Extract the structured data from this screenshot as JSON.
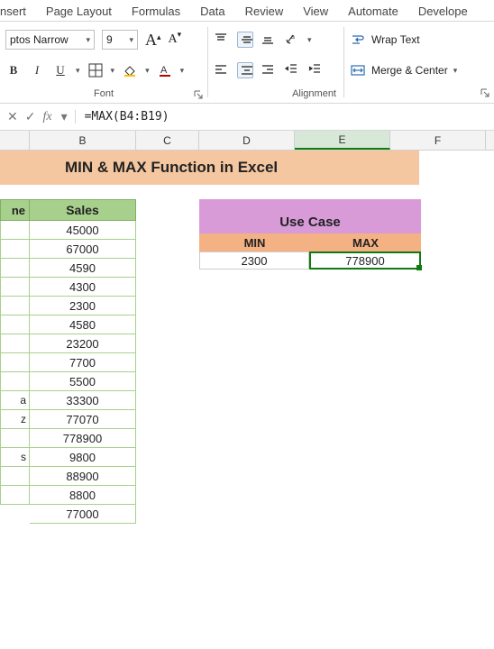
{
  "tabs": {
    "insert": "nsert",
    "page_layout": "Page Layout",
    "formulas": "Formulas",
    "data": "Data",
    "review": "Review",
    "view": "View",
    "automate": "Automate",
    "developer": "Develope"
  },
  "ribbon": {
    "font_name": "ptos Narrow",
    "font_size": "9",
    "group_font": "Font",
    "group_align": "Alignment",
    "wrap": "Wrap Text",
    "merge": "Merge & Center",
    "bold": "B",
    "italic": "I",
    "underline": "U"
  },
  "fbar": {
    "formula": "=MAX(B4:B19)",
    "fx": "fx"
  },
  "cols": {
    "B": "B",
    "C": "C",
    "D": "D",
    "E": "E",
    "F": "F"
  },
  "title": "MIN & MAX Function in Excel",
  "headers": {
    "name": "ne",
    "sales": "Sales"
  },
  "name_tail": [
    "",
    "",
    "",
    "",
    "",
    "",
    "",
    "",
    "",
    "a",
    "z",
    "",
    "s",
    "",
    ""
  ],
  "sales": [
    "45000",
    "67000",
    "4590",
    "4300",
    "2300",
    "4580",
    "23200",
    "7700",
    "5500",
    "33300",
    "77070",
    "778900",
    "9800",
    "88900",
    "8800",
    "77000"
  ],
  "usecase": {
    "title": "Use Case",
    "min_lbl": "MIN",
    "max_lbl": "MAX",
    "min": "2300",
    "max": "778900"
  },
  "chart_data": {
    "type": "table",
    "title": "MIN & MAX Function in Excel",
    "columns": [
      "Sales"
    ],
    "values": [
      45000,
      67000,
      4590,
      4300,
      2300,
      4580,
      23200,
      7700,
      5500,
      33300,
      77070,
      778900,
      9800,
      88900,
      8800,
      77000
    ],
    "aggregates": {
      "MIN": 2300,
      "MAX": 778900
    },
    "formula": "=MAX(B4:B19)"
  }
}
